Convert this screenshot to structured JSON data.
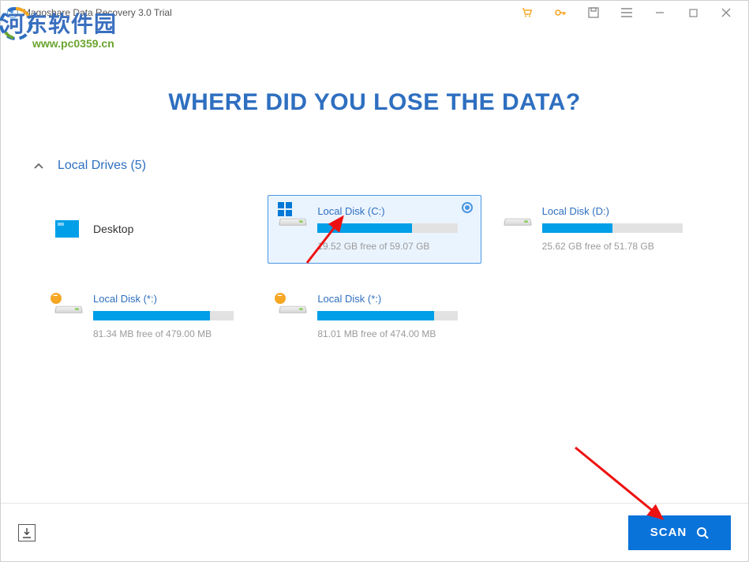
{
  "app": {
    "title": "Magoshare Data Recovery 3.0 Trial"
  },
  "watermark": {
    "text": "河东软件园",
    "url": "www.pc0359.cn"
  },
  "heading": "WHERE DID YOU LOSE THE DATA?",
  "section": {
    "label": "Local Drives (5)"
  },
  "drives": [
    {
      "name": "Desktop",
      "type": "desktop",
      "selected": false
    },
    {
      "name": "Local Disk (C:)",
      "type": "win",
      "free": "19.52 GB free of 59.07 GB",
      "used_pct": 67,
      "selected": true
    },
    {
      "name": "Local Disk (D:)",
      "type": "hdd",
      "free": "25.62 GB free of 51.78 GB",
      "used_pct": 50,
      "selected": false
    },
    {
      "name": "Local Disk (*:)",
      "type": "hdd-warn",
      "free": "81.34 MB free of 479.00 MB",
      "used_pct": 83,
      "selected": false
    },
    {
      "name": "Local Disk (*:)",
      "type": "hdd-warn",
      "free": "81.01 MB free of 474.00 MB",
      "used_pct": 83,
      "selected": false
    }
  ],
  "footer": {
    "scan_label": "SCAN"
  }
}
